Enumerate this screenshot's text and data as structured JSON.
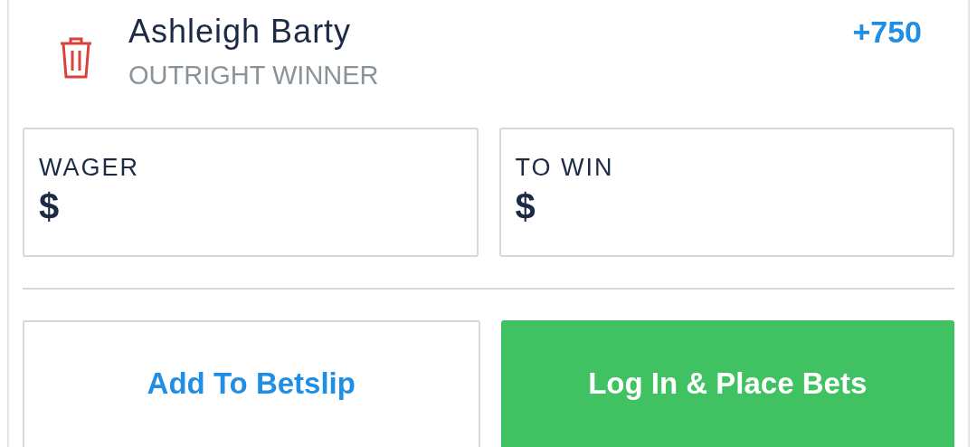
{
  "selection": {
    "name": "Ashleigh Barty",
    "market": "OUTRIGHT WINNER",
    "odds": "+750"
  },
  "fields": [
    {
      "label": "WAGER",
      "prefix": "$"
    },
    {
      "label": "TO WIN",
      "prefix": "$"
    }
  ],
  "buttons": [
    {
      "label": "Add To Betslip",
      "kind": "secondary"
    },
    {
      "label": "Log In & Place Bets",
      "kind": "primary"
    }
  ]
}
